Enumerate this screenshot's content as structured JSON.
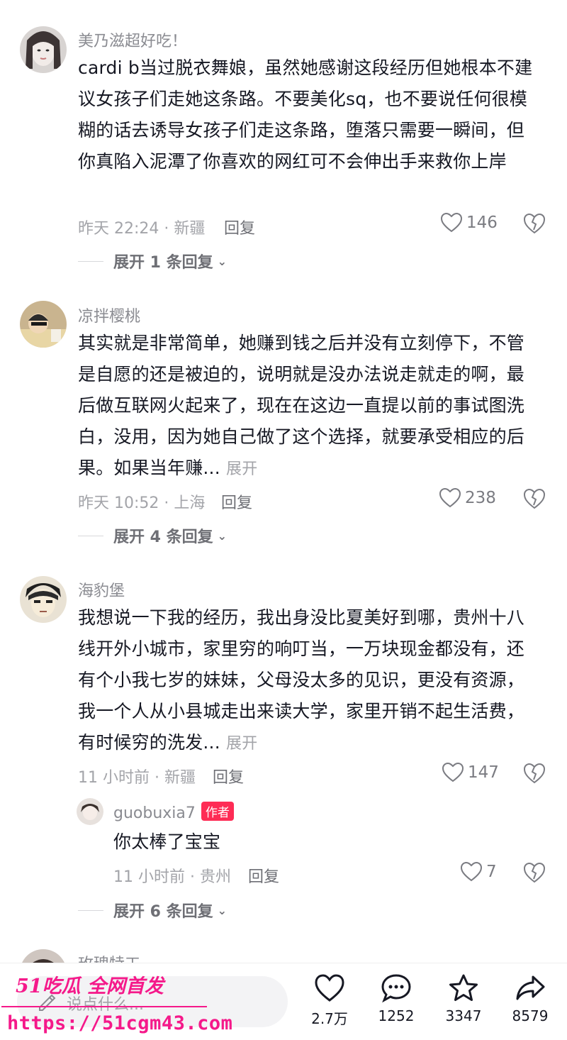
{
  "comments": [
    {
      "username": "美乃滋超好吃！",
      "text": "cardi b当过脱衣舞娘，虽然她感谢这段经历但她根本不建议女孩子们走她这条路。不要美化sq，也不要说任何很模糊的话去诱导女孩子们走这条路，堕落只需要一瞬间，但你真陷入泥潭了你喜欢的网红可不会伸出手来救你上岸",
      "meta": "昨天 22:24 · 新疆",
      "reply_label": "回复",
      "likes": "146",
      "expand_label": "展开 1 条回复"
    },
    {
      "username": "凉拌樱桃",
      "text": "其实就是非常简单，她赚到钱之后并没有立刻停下，不管是自愿的还是被迫的，说明就是没办法说走就走的啊，最后做互联网火起来了，现在在这边一直提以前的事试图洗白，没用，因为她自己做了这个选择，就要承受相应的后果。如果当年赚...",
      "more_label": "展开",
      "meta": "昨天 10:52 · 上海",
      "reply_label": "回复",
      "likes": "238",
      "expand_label": "展开 4 条回复"
    },
    {
      "username": "海豹堡",
      "text": "我想说一下我的经历，我出身没比夏美好到哪，贵州十八线开外小城市，家里穷的响叮当，一万块现金都没有，还有个小我七岁的妹妹，父母没太多的见识，更没有资源，我一个人从小县城走出来读大学，家里开销不起生活费，有时候穷的洗发...",
      "more_label": "展开",
      "meta": "11 小时前 · 新疆",
      "reply_label": "回复",
      "likes": "147",
      "expand_label": "展开 6 条回复"
    }
  ],
  "sub_reply": {
    "username": "guobuxia7",
    "tag": "作者",
    "text": "你太棒了宝宝",
    "meta": "11 小时前 · 贵州",
    "reply_label": "回复",
    "likes": "7"
  },
  "partial_username": "玫瑰特工",
  "bottom_bar": {
    "placeholder": "说点什么...",
    "likes": "2.7万",
    "comments": "1252",
    "favorites": "3347",
    "shares": "8579"
  },
  "watermark": {
    "line1": "51吃瓜 全网首发",
    "line2": "https://51cgm43.com"
  },
  "colors": {
    "accent": "#fe2c55",
    "watermark": "#f5198a"
  }
}
